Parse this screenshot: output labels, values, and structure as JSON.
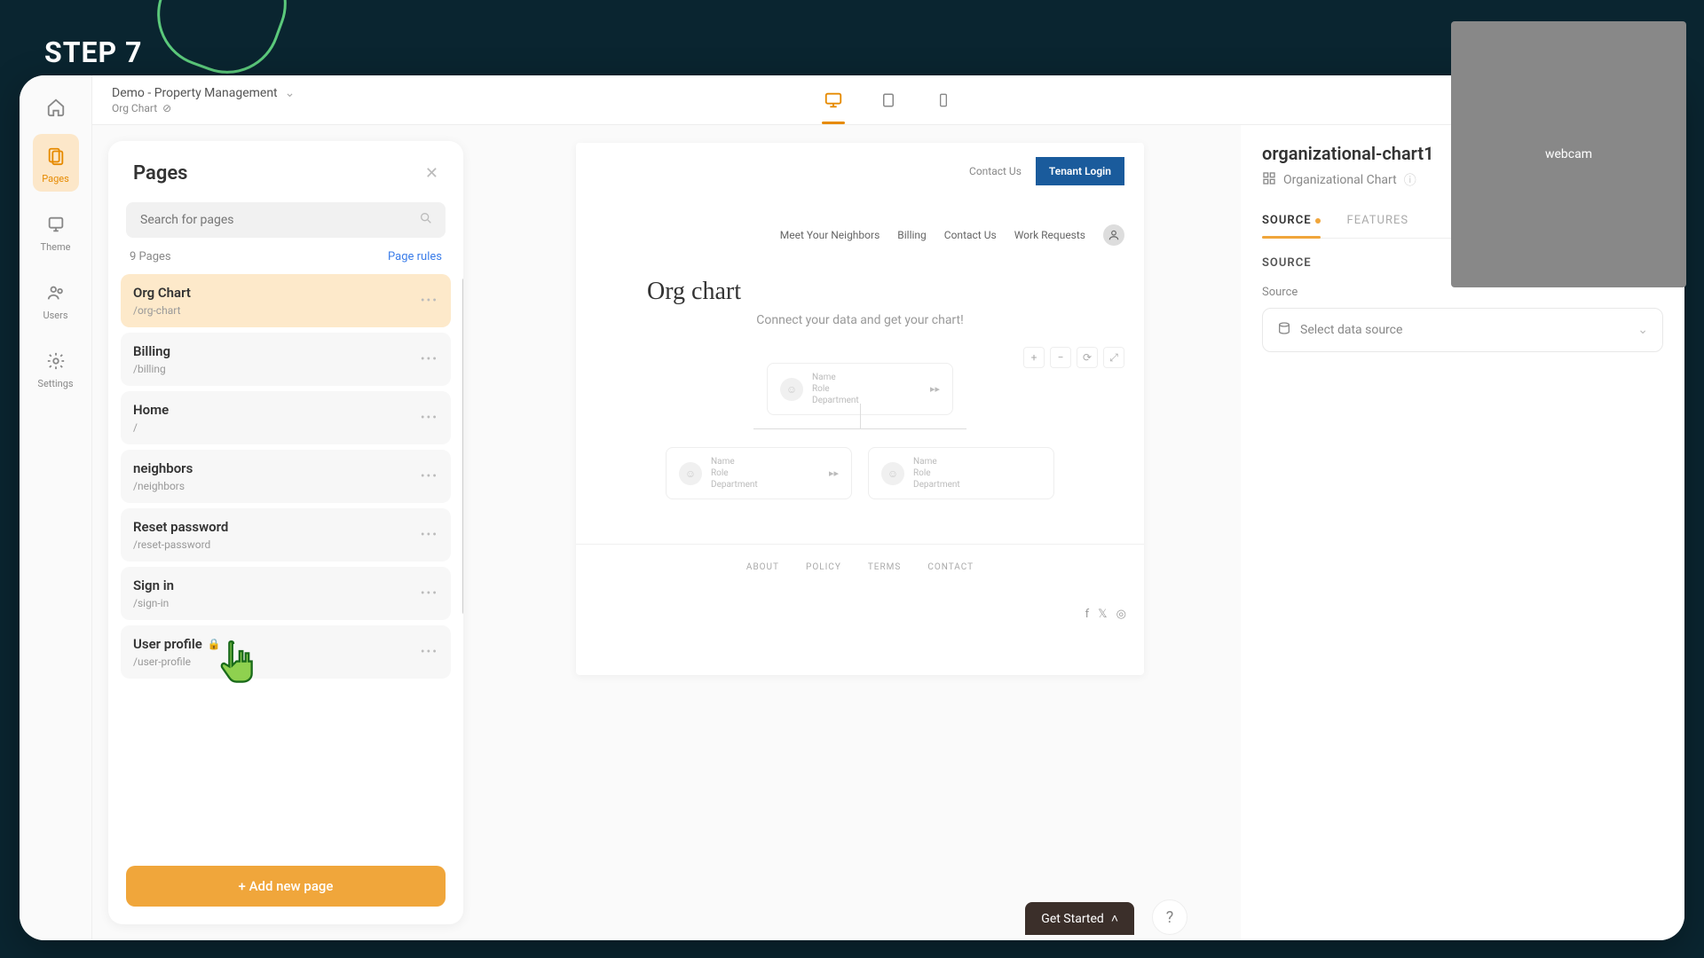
{
  "overlay": {
    "step_label": "STEP 7"
  },
  "header": {
    "project": "Demo - Property Management",
    "page": "Org Chart"
  },
  "rail": {
    "pages": "Pages",
    "theme": "Theme",
    "users": "Users",
    "settings": "Settings"
  },
  "pages_panel": {
    "title": "Pages",
    "search_placeholder": "Search for pages",
    "count": "9 Pages",
    "rules": "Page rules",
    "add_button": "+ Add new page",
    "items": [
      {
        "name": "Org Chart",
        "path": "/org-chart",
        "active": true
      },
      {
        "name": "Billing",
        "path": "/billing"
      },
      {
        "name": "Home",
        "path": "/"
      },
      {
        "name": "neighbors",
        "path": "/neighbors"
      },
      {
        "name": "Reset password",
        "path": "/reset-password"
      },
      {
        "name": "Sign in",
        "path": "/sign-in"
      },
      {
        "name": "User profile",
        "path": "/user-profile",
        "locked": true
      }
    ]
  },
  "canvas": {
    "contact_us": "Contact Us",
    "tenant_login": "Tenant Login",
    "nav": [
      "Meet Your Neighbors",
      "Billing",
      "Contact Us",
      "Work Requests"
    ],
    "title": "Org chart",
    "subtitle": "Connect your data and get your chart!",
    "node_labels": {
      "name": "Name",
      "role": "Role",
      "dept": "Department"
    },
    "footer_links": [
      "ABOUT",
      "POLICY",
      "TERMS",
      "CONTACT"
    ],
    "get_started": "Get Started"
  },
  "inspector": {
    "element_id": "organizational-chart1",
    "element_type": "Organizational Chart",
    "tab_source": "SOURCE",
    "tab_features": "FEATURES",
    "section_source": "SOURCE",
    "field_source": "Source",
    "select_placeholder": "Select data source"
  }
}
